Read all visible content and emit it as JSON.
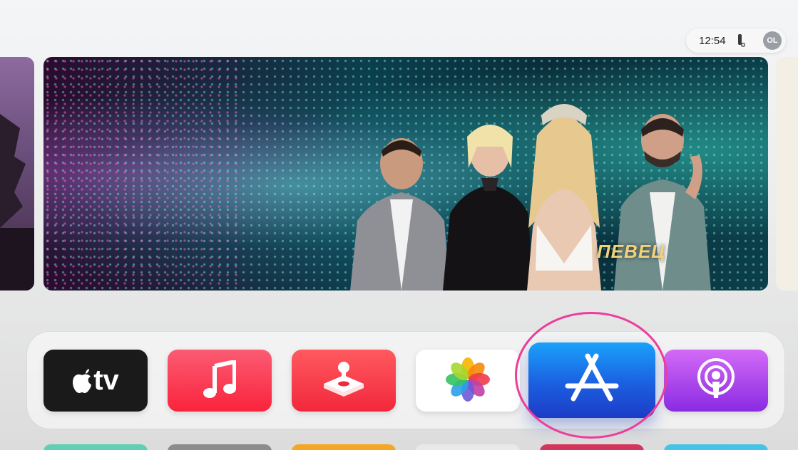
{
  "status_bar": {
    "time": "12:54",
    "remote_icon": "remote-icon",
    "avatar_initials": "OL"
  },
  "hero": {
    "show_logo_text": "ПЕВЕЦ"
  },
  "dock": {
    "apps": [
      {
        "name": "Apple TV",
        "icon": "apple-tv-icon",
        "label": "tv",
        "color": "#1a1a1a"
      },
      {
        "name": "Music",
        "icon": "music-note-icon",
        "color": "#fa233b"
      },
      {
        "name": "Arcade",
        "icon": "joystick-icon",
        "color": "#f2283c"
      },
      {
        "name": "Photos",
        "icon": "photos-flower-icon",
        "color": "#ffffff"
      },
      {
        "name": "App Store",
        "icon": "app-store-icon",
        "color": "#1b5fe0",
        "focused": true
      },
      {
        "name": "Podcasts",
        "icon": "podcasts-icon",
        "color": "#8a2be2"
      }
    ]
  },
  "highlight_color": "#ec3d9a"
}
